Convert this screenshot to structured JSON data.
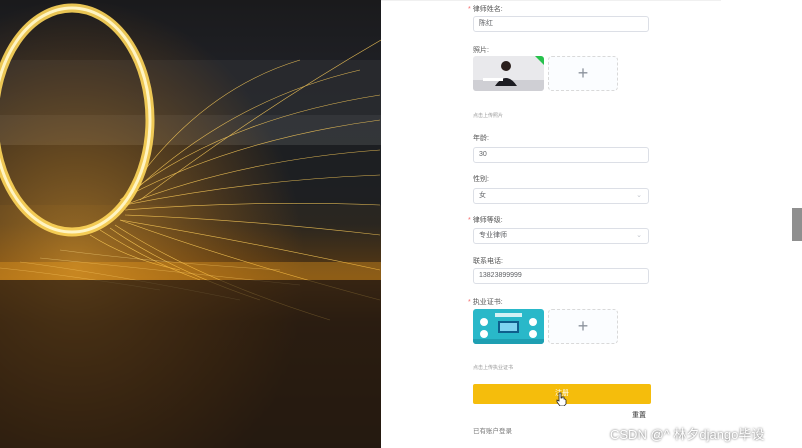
{
  "form": {
    "name_label": "律师姓名:",
    "name_value": "陈红",
    "photo_label": "照片:",
    "photo_tip": "点击上传照片",
    "age_label": "年龄:",
    "age_value": "30",
    "gender_label": "性别:",
    "gender_value": "女",
    "level_label": "律师等级:",
    "level_value": "专业律师",
    "phone_label": "联系电话:",
    "phone_value": "13823899999",
    "cert_label": "执业证书:",
    "cert_tip": "点击上传执业证书",
    "submit_label": "注册",
    "reset_label": "重置",
    "login_link": "已有账户登录"
  },
  "icons": {
    "add": "+",
    "arrow": "⌄",
    "required": "*"
  },
  "watermark": "CSDN @^ 林夕django毕设",
  "colors": {
    "accent": "#f5bd0c",
    "required": "#f56c6c",
    "border": "#dcdfe6"
  }
}
